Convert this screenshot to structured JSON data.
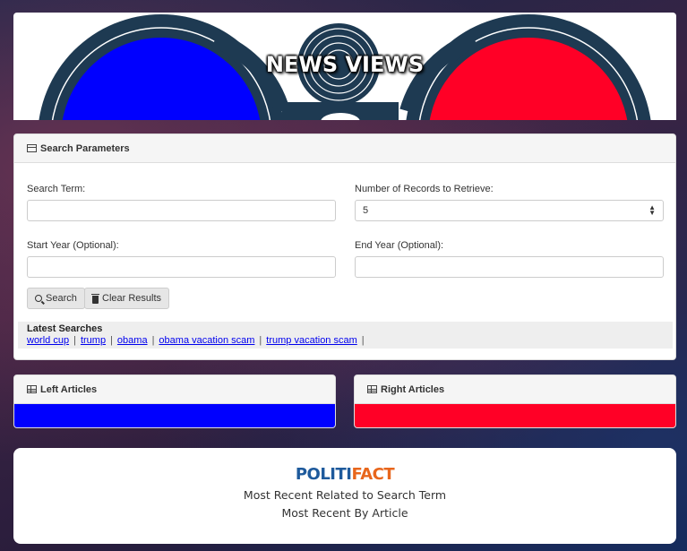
{
  "banner": {
    "title": "NEWS VIEWS",
    "left_color": "#0000ff",
    "right_color": "#ff0026",
    "frame_color": "#1e3a52"
  },
  "search": {
    "heading": "Search Parameters",
    "heading_icon": "card-icon",
    "term_label": "Search Term:",
    "term_value": "",
    "records_label": "Number of Records to Retrieve:",
    "records_value": "5",
    "start_label": "Start Year (Optional):",
    "start_value": "",
    "end_label": "End Year (Optional):",
    "end_value": "",
    "search_button": "Search",
    "clear_button": "Clear Results"
  },
  "latest": {
    "title": "Latest Searches",
    "items": [
      "world cup",
      "trump",
      "obama",
      "obama vacation scam",
      "trump vacation scam"
    ]
  },
  "left_articles": {
    "heading": "Left Articles",
    "color": "#0000ff"
  },
  "right_articles": {
    "heading": "Right Articles",
    "color": "#ff0026"
  },
  "politifact": {
    "logo_part1": "POLITI",
    "logo_part2": "FACT",
    "line1": "Most Recent Related to Search Term",
    "line2": "Most Recent By Article"
  }
}
